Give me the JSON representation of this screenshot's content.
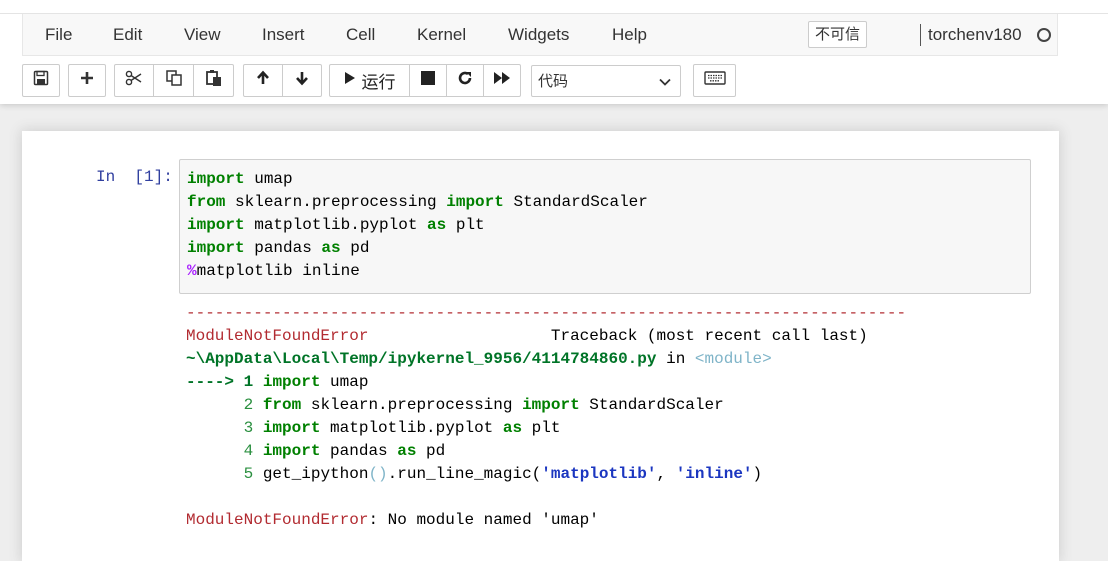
{
  "menubar": {
    "items": [
      "File",
      "Edit",
      "View",
      "Insert",
      "Cell",
      "Kernel",
      "Widgets",
      "Help"
    ],
    "trusted_label": "不可信",
    "kernel_name": "torchenv180"
  },
  "toolbar": {
    "run_label": "运行",
    "cell_type": "代码"
  },
  "cell": {
    "prompt": "In  [1]:",
    "code": [
      {
        "kw": "import",
        "rest": " umap"
      },
      {
        "kw": "from",
        "rest": " sklearn.preprocessing ",
        "kw2": "import",
        "rest2": " StandardScaler"
      },
      {
        "kw": "import",
        "rest": " matplotlib.pyplot ",
        "kw2": "as",
        "rest2": " plt"
      },
      {
        "kw": "import",
        "rest": " pandas ",
        "kw2": "as",
        "rest2": " pd"
      },
      {
        "pct": "%",
        "rest": "matplotlib inline"
      }
    ]
  },
  "output": {
    "separator": "---------------------------------------------------------------------------",
    "error_name": "ModuleNotFoundError",
    "traceback_header": "Traceback (most recent call last)",
    "file_path": "~\\AppData\\Local\\Temp/ipykernel_9956/4114784860.py",
    "in_text": " in ",
    "module_text": "<module>",
    "arrow": "---->",
    "tb_lines": [
      {
        "num": "1",
        "kw": "import",
        "rest": " umap"
      },
      {
        "num": "2",
        "kw": "from",
        "rest": " sklearn.preprocessing ",
        "kw2": "import",
        "rest2": " StandardScaler"
      },
      {
        "num": "3",
        "kw": "import",
        "rest": " matplotlib.pyplot ",
        "kw2": "as",
        "rest2": " plt"
      },
      {
        "num": "4",
        "kw": "import",
        "rest": " pandas ",
        "kw2": "as",
        "rest2": " pd"
      }
    ],
    "line5_num": "5",
    "line5_fn": "get_ipython",
    "line5_paren": "()",
    "line5_call": ".run_line_magic(",
    "line5_arg1": "'matplotlib'",
    "line5_comma": ", ",
    "line5_arg2": "'inline'",
    "line5_close": ")",
    "error_message": ": No module named 'umap'"
  }
}
